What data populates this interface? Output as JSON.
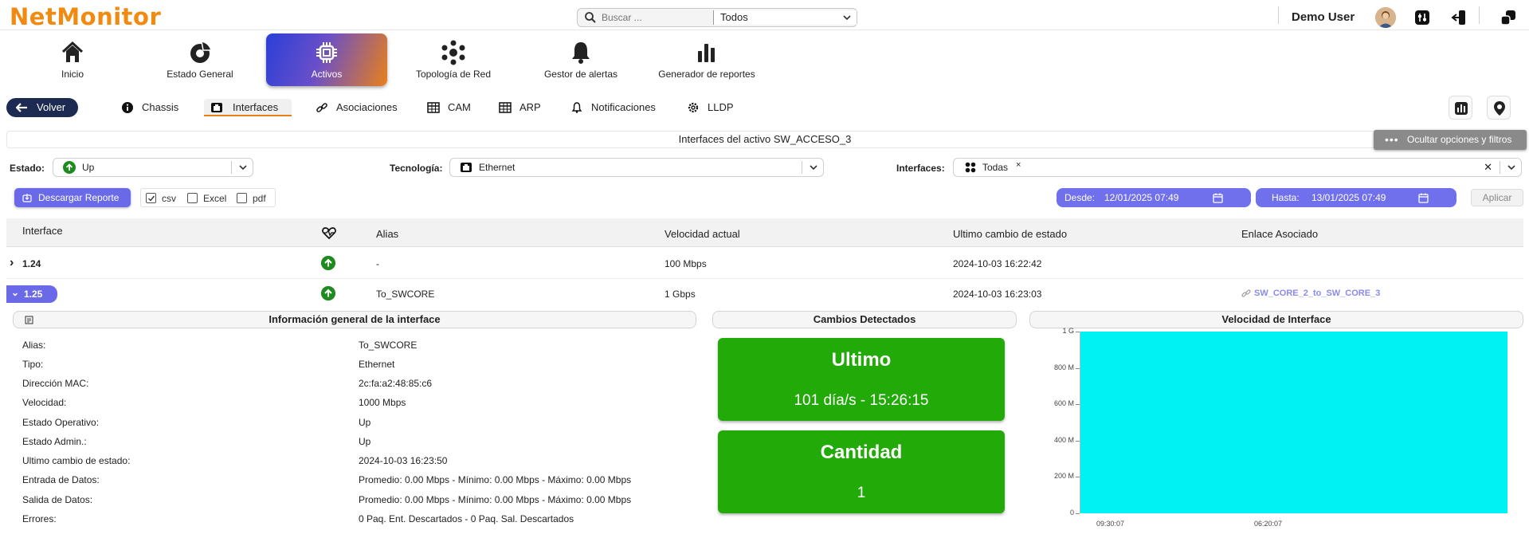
{
  "app": {
    "logo": "NetMonitor"
  },
  "search": {
    "placeholder": "Buscar ...",
    "scope": "Todos"
  },
  "user": {
    "name": "Demo User"
  },
  "nav": [
    {
      "label": "Inicio",
      "icon": "home-icon"
    },
    {
      "label": "Estado General",
      "icon": "dashboard-icon"
    },
    {
      "label": "Activos",
      "icon": "chip-icon",
      "active": true
    },
    {
      "label": "Topología de Red",
      "icon": "network-icon"
    },
    {
      "label": "Gestor de alertas",
      "icon": "bell-icon"
    },
    {
      "label": "Generador de reportes",
      "icon": "bar-chart-icon"
    }
  ],
  "subnav": {
    "back_label": "Volver",
    "tabs": [
      {
        "label": "Chassis",
        "icon": "info-icon"
      },
      {
        "label": "Interfaces",
        "icon": "ethernet-icon",
        "active": true
      },
      {
        "label": "Asociaciones",
        "icon": "link-icon"
      },
      {
        "label": "CAM",
        "icon": "table-icon"
      },
      {
        "label": "ARP",
        "icon": "table-icon"
      },
      {
        "label": "Notificaciones",
        "icon": "bell-icon"
      },
      {
        "label": "LLDP",
        "icon": "gear-icon"
      }
    ]
  },
  "page": {
    "title": "Interfaces del activo SW_ACCESO_3",
    "hide_filters_label": "Ocultar opciones y filtros"
  },
  "filters": {
    "estado_label": "Estado:",
    "estado_value": "Up",
    "tecnologia_label": "Tecnología:",
    "tecnologia_value": "Ethernet",
    "interfaces_label": "Interfaces:",
    "interfaces_value": "Todas",
    "chip_remove": "×",
    "clear_glyph": "✕"
  },
  "report": {
    "download_label": "Descargar Reporte",
    "formats": [
      {
        "label": "csv",
        "checked": true
      },
      {
        "label": "Excel",
        "checked": false
      },
      {
        "label": "pdf",
        "checked": false
      }
    ],
    "desde_label": "Desde:",
    "desde_value": "12/01/2025 07:49",
    "hasta_label": "Hasta:",
    "hasta_value": "13/01/2025 07:49",
    "apply_label": "Aplicar"
  },
  "table": {
    "headers": {
      "interface": "Interface",
      "alias": "Alias",
      "speed": "Velocidad actual",
      "last_change": "Ultimo cambio de estado",
      "link": "Enlace Asociado"
    },
    "rows": [
      {
        "expand": "›",
        "interface": "1.24",
        "alias": "-",
        "speed": "100 Mbps",
        "last_change": "2024-10-03 16:22:42",
        "link": ""
      },
      {
        "expand": "⌄",
        "interface": "1.25",
        "alias": "To_SWCORE",
        "speed": "1 Gbps",
        "last_change": "2024-10-03 16:23:03",
        "link": "SW_CORE_2_to_SW_CORE_3"
      }
    ]
  },
  "detail": {
    "info_title": "Información general de la interface",
    "changes_title": "Cambios Detectados",
    "speed_title": "Velocidad de Interface",
    "info": [
      {
        "label": "Alias:",
        "value": "To_SWCORE"
      },
      {
        "label": "Tipo:",
        "value": "Ethernet"
      },
      {
        "label": "Dirección MAC:",
        "value": "2c:fa:a2:48:85:c6"
      },
      {
        "label": "Velocidad:",
        "value": "1000 Mbps"
      },
      {
        "label": "Estado Operativo:",
        "value": "Up"
      },
      {
        "label": "Estado Admin.:",
        "value": "Up"
      },
      {
        "label": "Ultimo cambio de estado:",
        "value": "2024-10-03 16:23:50"
      },
      {
        "label": "Entrada de Datos:",
        "value": "Promedio: 0.00 Mbps - Mínimo: 0.00 Mbps - Máximo: 0.00 Mbps"
      },
      {
        "label": "Salida de Datos:",
        "value": "Promedio: 0.00 Mbps - Mínimo: 0.00 Mbps - Máximo: 0.00 Mbps"
      },
      {
        "label": "Errores:",
        "value": "0 Paq. Ent. Descartados - 0 Paq. Sal. Descartados"
      }
    ],
    "cards": [
      {
        "title": "Ultimo",
        "value": "101 día/s - 15:26:15"
      },
      {
        "title": "Cantidad",
        "value": "1"
      }
    ]
  },
  "colors": {
    "brand": "#f08a10",
    "accent": "#6a6ae8",
    "status_up": "#1d8b1d",
    "card_green": "#22aa08",
    "chart_fill": "#00f2f2"
  },
  "chart_data": {
    "type": "area",
    "title": "Velocidad de Interface",
    "xlabel": "",
    "ylabel": "",
    "y_ticks": [
      "0",
      "200 M",
      "400 M",
      "600 M",
      "800 M",
      "1 G"
    ],
    "x_ticks": [
      "09:30:07",
      "06:20:07"
    ],
    "ylim": [
      0,
      1000
    ],
    "series": [
      {
        "values": [
          1000,
          1000
        ]
      }
    ]
  }
}
